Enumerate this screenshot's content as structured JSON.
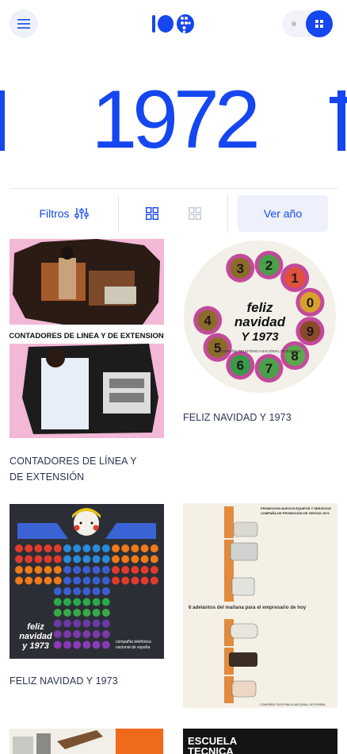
{
  "header": {
    "menu_icon": "hamburger-menu-icon",
    "logo_icon": "telefonica-100-logo",
    "view_toggle_icon": "grid-dots-icon"
  },
  "year": {
    "title": "1972"
  },
  "controls": {
    "filters_label": "Filtros",
    "filters_icon": "sliders-icon",
    "grid_large_icon": "grid-large-icon",
    "grid_small_icon": "grid-small-icon",
    "see_year_label": "Ver año"
  },
  "colors": {
    "accent": "#1546f0",
    "text": "#2b3553",
    "divider": "#e3e6ee"
  },
  "items": [
    {
      "caption": "CONTADORES DE LÍNEA Y DE EXTENSIÓN",
      "poster_text": "CONTADORES DE LINEA Y DE EXTENSION"
    },
    {
      "caption": "FELIZ NAVIDAD Y 1973",
      "poster_line1": "feliz",
      "poster_line2": "navidad",
      "poster_line3": "Y 1973",
      "poster_sub": "COMPAÑIA TELEFONICA NACIONAL DE ESPAÑA",
      "dial_digits": [
        "3",
        "2",
        "1",
        "0",
        "9",
        "8",
        "7",
        "6",
        "5",
        "4"
      ]
    },
    {
      "caption": "FELIZ NAVIDAD Y 1973",
      "poster_line1": "feliz",
      "poster_line2": "navidad",
      "poster_line3": "y 1973",
      "poster_sub1": "compañía telefónica",
      "poster_sub2": "nacional de españa"
    },
    {
      "caption": "",
      "poster_head1": "PROMOCION NUEVOS EQUIPOS Y SERVICIOS",
      "poster_head2": "CAMPAÑA DE PROMOCION DE VENTAS 1972",
      "poster_mid": "6 adelantos del mañana para el empresario de hoy",
      "poster_foot": "COMPAÑIA TELEFONICA NACIONAL DE ESPAÑA"
    },
    {
      "caption": ""
    },
    {
      "caption": "",
      "poster_line1": "ESCUELA",
      "poster_line2": "TECNICA"
    }
  ]
}
